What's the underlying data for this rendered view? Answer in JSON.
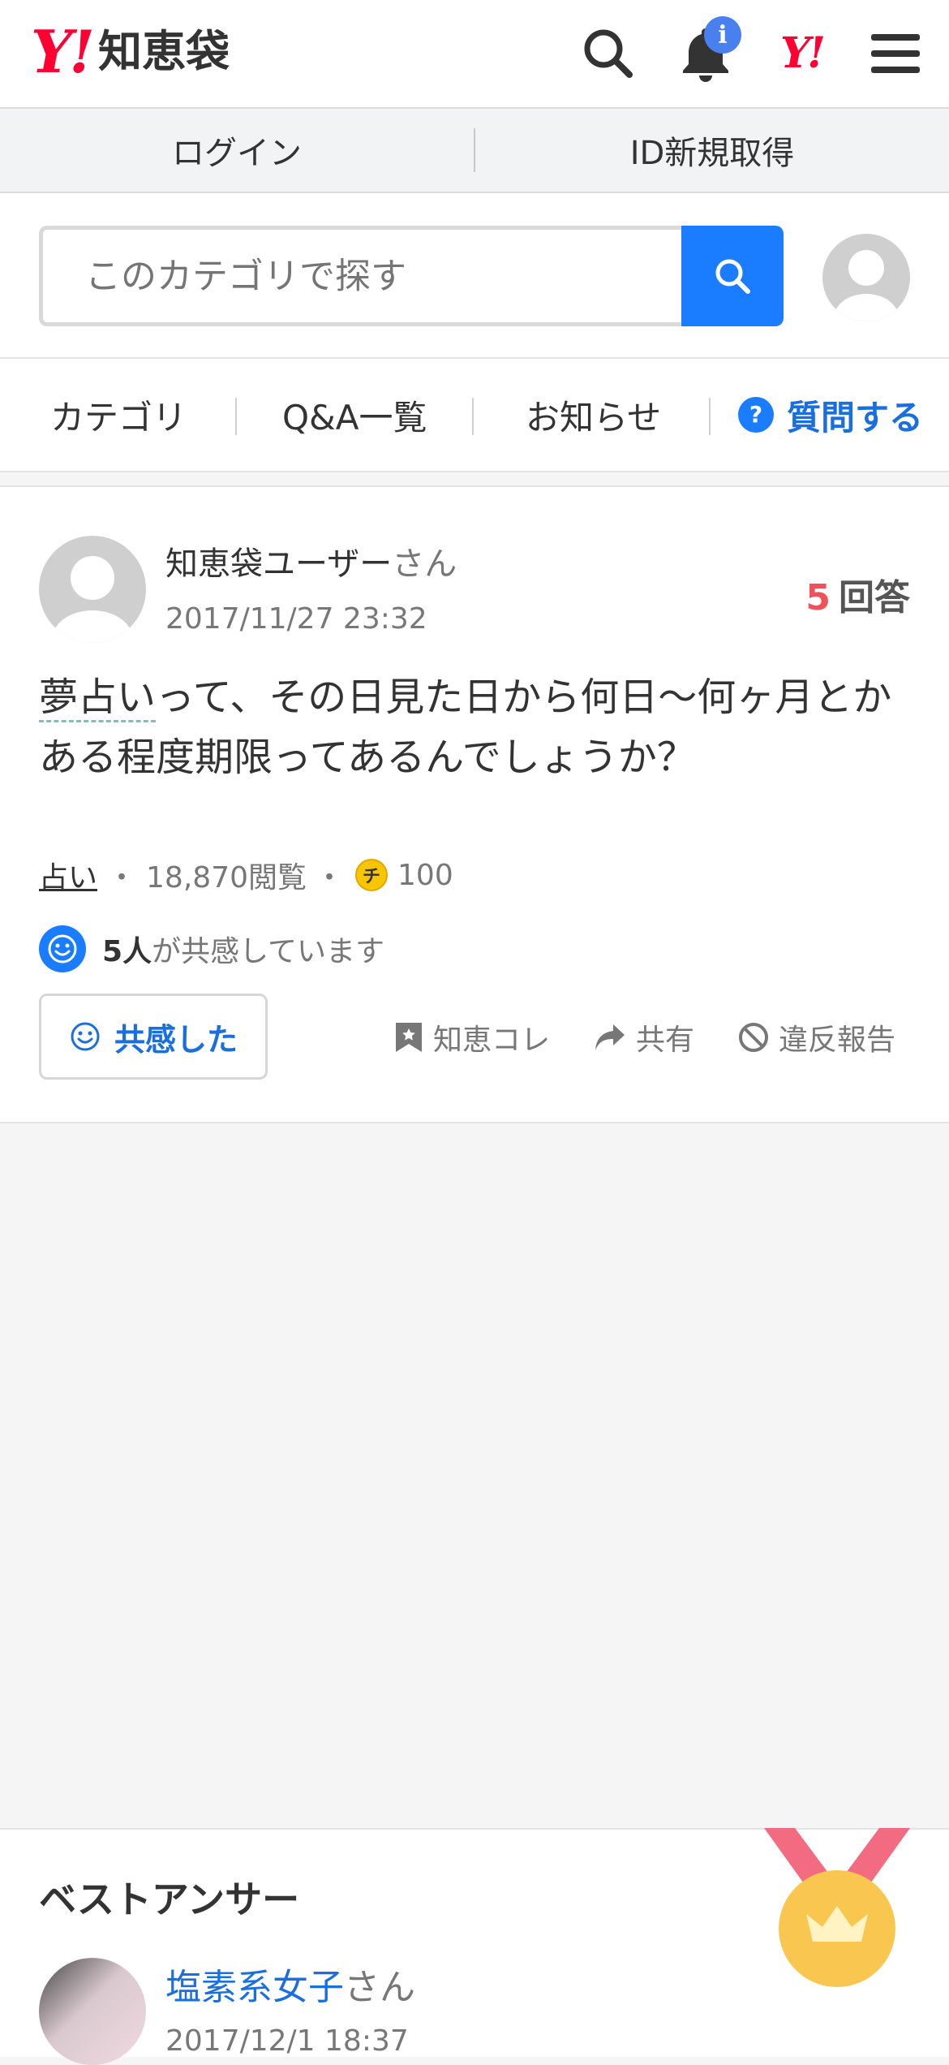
{
  "header": {
    "logo_y": "Y!",
    "logo_text": "知恵袋",
    "notification_badge": "i",
    "yahoo_mark": "Y!"
  },
  "login_bar": {
    "login": "ログイン",
    "register": "ID新規取得"
  },
  "search": {
    "placeholder": "このカテゴリで探す"
  },
  "nav": {
    "items": [
      "カテゴリ",
      "Q&A一覧",
      "お知らせ"
    ],
    "ask": "質問する"
  },
  "question": {
    "user": "知恵袋ユーザー",
    "user_suffix": "さん",
    "date": "2017/11/27 23:32",
    "answer_count": "5",
    "answer_label": "回答",
    "keyword": "夢占い",
    "body_rest": "って、その日見た日から何日〜何ヶ月とかある程度期限ってあるんでしょうか？",
    "category": "占い",
    "views": "18,870閲覧",
    "coin_mark": "チ",
    "coins": "100",
    "empathy_count": "5人",
    "empathy_text": "が共感しています",
    "empathy_button": "共感した",
    "actions": {
      "bookmark": "知恵コレ",
      "share": "共有",
      "report": "違反報告"
    }
  },
  "best_answer": {
    "title": "ベストアンサー",
    "user": "塩素系女子",
    "user_suffix": "さん",
    "date": "2017/12/1 18:37"
  },
  "colors": {
    "brand_red": "#ff0033",
    "accent_blue": "#1a7cff",
    "answer_count_red": "#f0525a",
    "medal_gold": "#f9c74f"
  }
}
